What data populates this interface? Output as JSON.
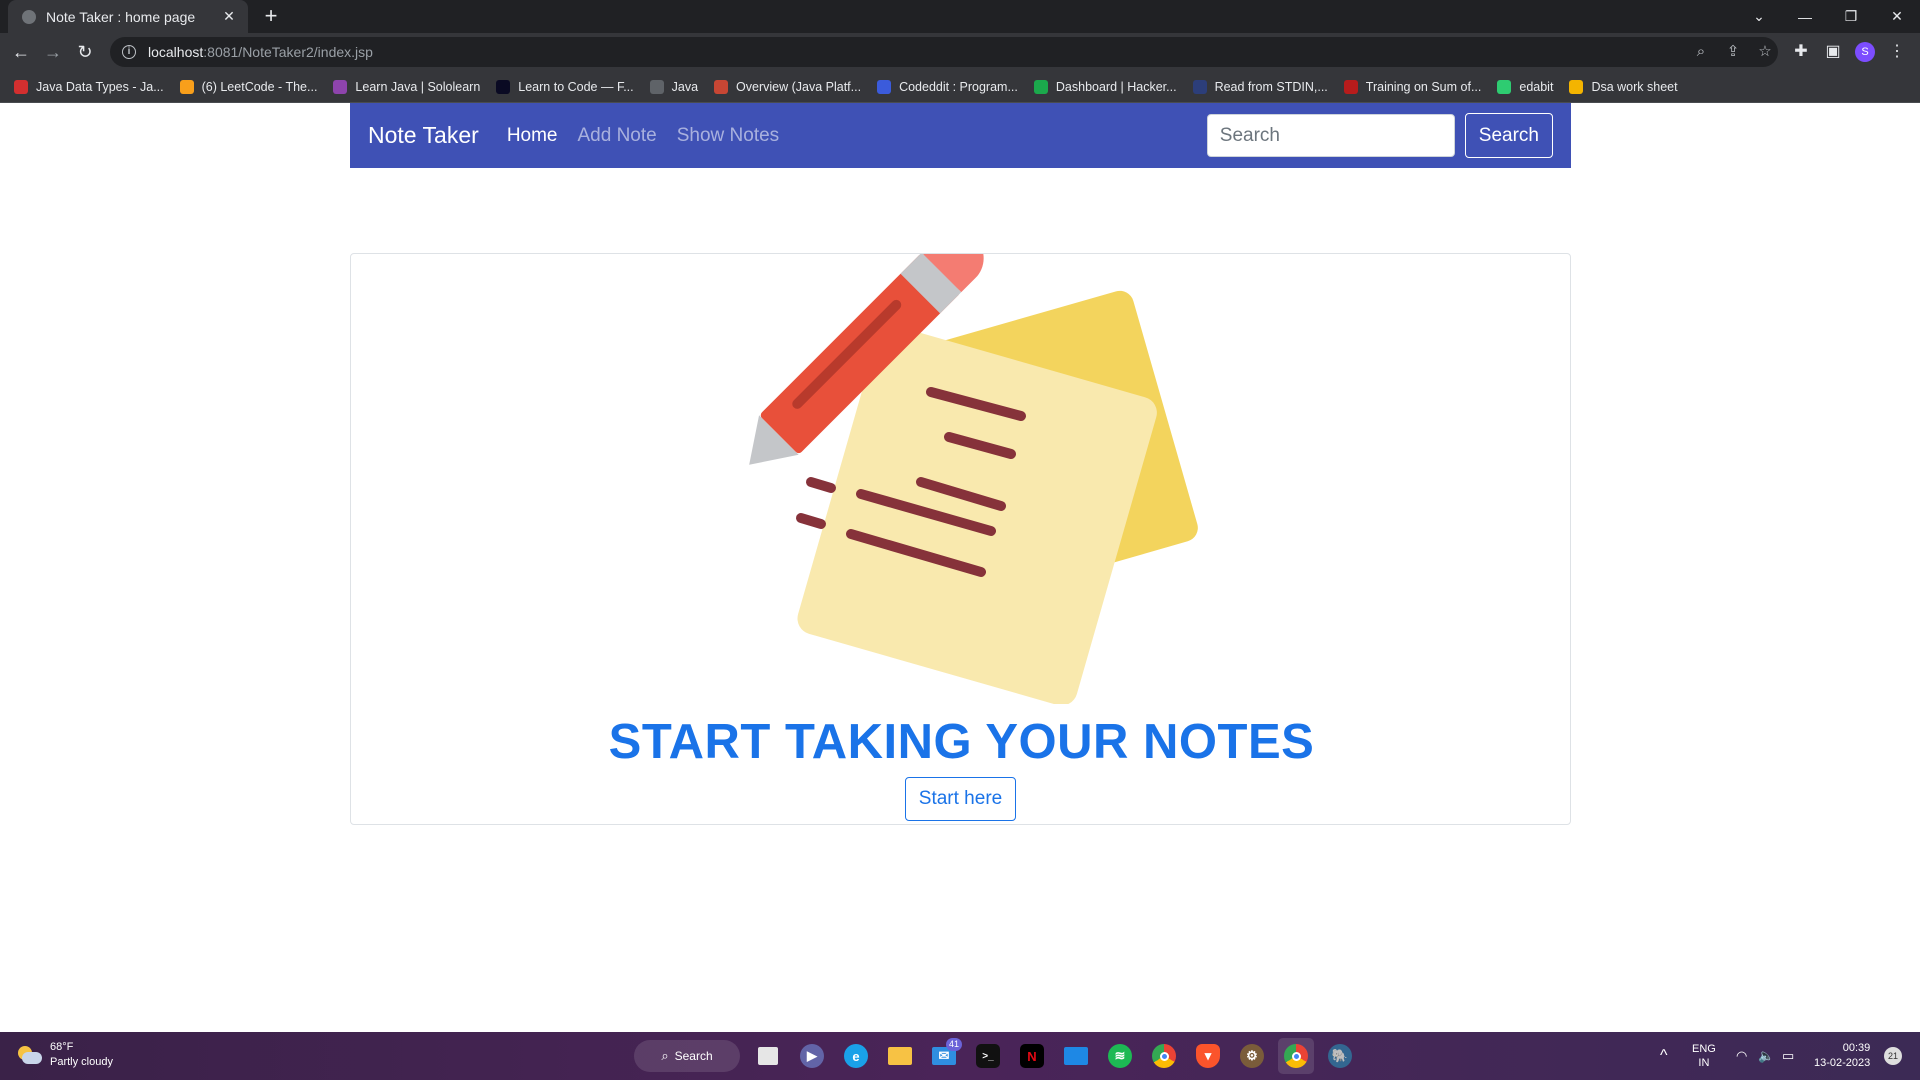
{
  "browser": {
    "tab_title": "Note Taker : home page",
    "url_host": "localhost",
    "url_rest": ":8081/NoteTaker2/index.jsp"
  },
  "bookmarks": [
    {
      "label": "Java Data Types - Ja...",
      "color": "#d32f2f"
    },
    {
      "label": "(6) LeetCode - The...",
      "color": "#f89f1b"
    },
    {
      "label": "Learn Java | Sololearn",
      "color": "#8e44ad"
    },
    {
      "label": "Learn to Code — F...",
      "color": "#0a0a23"
    },
    {
      "label": "Java",
      "color": "#5f6368"
    },
    {
      "label": "Overview (Java Platf...",
      "color": "#c74634"
    },
    {
      "label": "Codeddit : Program...",
      "color": "#3b5bdb"
    },
    {
      "label": "Dashboard | Hacker...",
      "color": "#1ba94c"
    },
    {
      "label": "Read from STDIN,...",
      "color": "#2c3e7a"
    },
    {
      "label": "Training on Sum of...",
      "color": "#b71c1c"
    },
    {
      "label": "edabit",
      "color": "#2ecc71"
    },
    {
      "label": "Dsa work sheet",
      "color": "#f4b400"
    }
  ],
  "navbar": {
    "brand": "Note Taker",
    "links": [
      "Home",
      "Add Note",
      "Show Notes"
    ],
    "search_placeholder": "Search",
    "search_button": "Search"
  },
  "hero": {
    "headline": "START TAKING YOUR NOTES",
    "button": "Start here"
  },
  "taskbar": {
    "temperature": "68°F",
    "weather": "Partly cloudy",
    "search_label": "Search",
    "mail_badge": "41",
    "lang_top": "ENG",
    "lang_bottom": "IN",
    "time": "00:39",
    "date": "13-02-2023",
    "notifications": "21"
  },
  "colors": {
    "navbar": "#3f51b5",
    "primary": "#1a73e8"
  }
}
